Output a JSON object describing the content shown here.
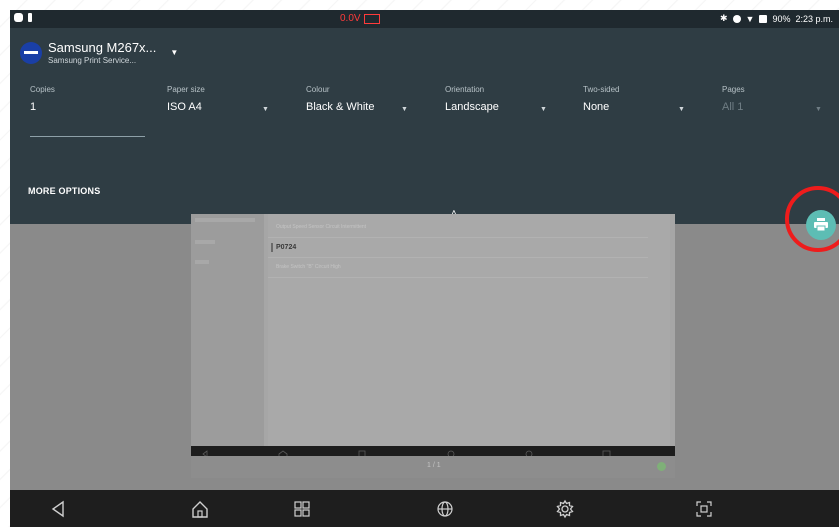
{
  "status_bar": {
    "voltage": "0.0V",
    "battery": "90%",
    "time": "2:23 p.m."
  },
  "printer": {
    "name": "Samsung M267x...",
    "service": "Samsung Print Service..."
  },
  "options": [
    {
      "key": "copies",
      "label": "Copies",
      "value": "1"
    },
    {
      "key": "paper_size",
      "label": "Paper size",
      "value": "ISO A4"
    },
    {
      "key": "colour",
      "label": "Colour",
      "value": "Black & White"
    },
    {
      "key": "orientation",
      "label": "Orientation",
      "value": "Landscape"
    },
    {
      "key": "two_sided",
      "label": "Two-sided",
      "value": "None"
    },
    {
      "key": "pages",
      "label": "Pages",
      "value": "All 1"
    }
  ],
  "more_options_label": "MORE OPTIONS",
  "preview": {
    "rows": [
      "Output Speed Sensor Circuit Intermittent",
      "P0724",
      "Brake Switch \"B\" Circuit High"
    ],
    "page_indicator": "1 / 1"
  },
  "colors": {
    "panel_bg": "#2f3d44",
    "fab": "#5dbdb4",
    "highlight_circle": "#ee1c1c",
    "status_voltage": "#ff3b3b"
  },
  "icons": [
    "back-icon",
    "home-icon",
    "apps-icon",
    "browser-icon",
    "settings-icon",
    "screenshot-icon",
    "print-icon"
  ]
}
